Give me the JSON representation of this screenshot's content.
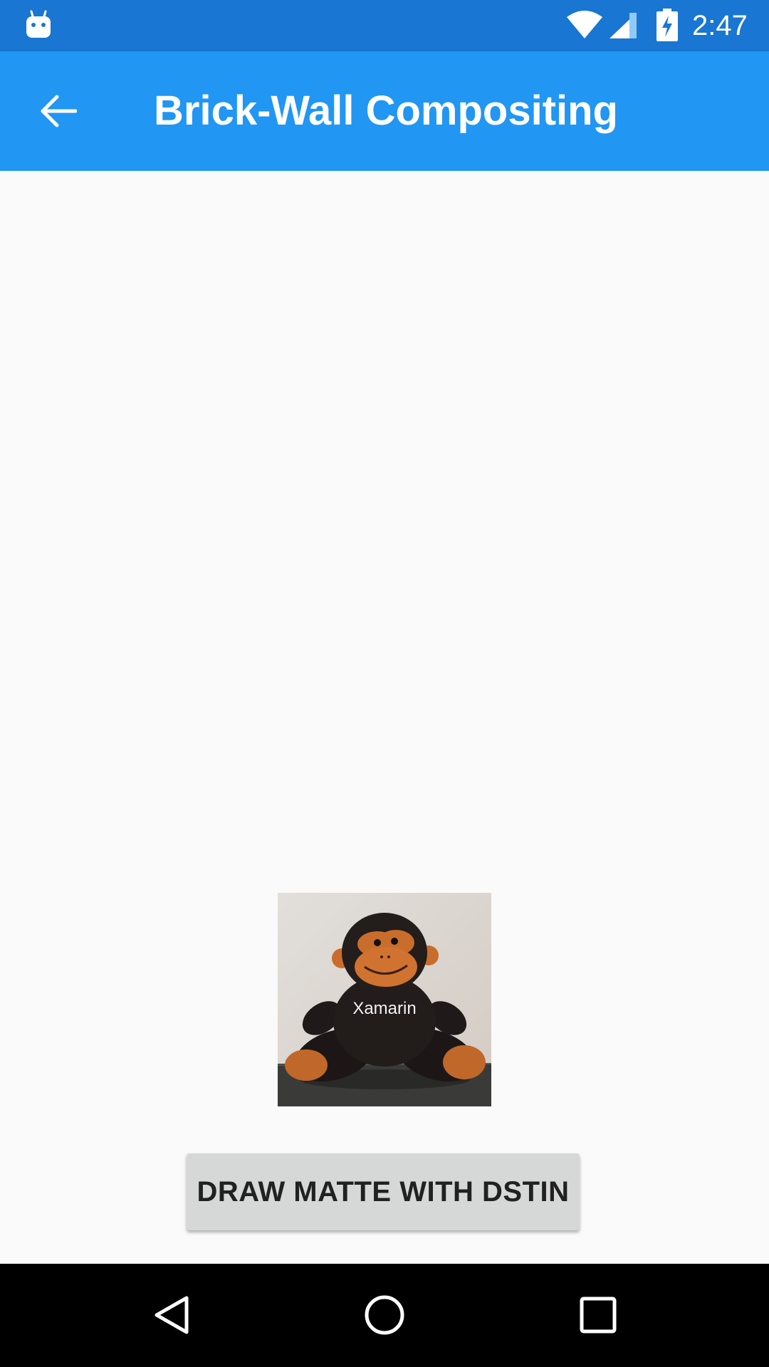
{
  "status_bar": {
    "time": "2:47",
    "icons": [
      "android-notification-icon",
      "wifi-icon",
      "cell-signal-icon",
      "battery-charging-icon"
    ]
  },
  "app_bar": {
    "title": "Brick-Wall Compositing",
    "back_icon": "arrow-back-icon"
  },
  "main": {
    "image": {
      "description_icon": "monkey-plush-photo",
      "shirt_text": "Xamarin"
    },
    "button_label": "DRAW MATTE WITH DSTIN"
  },
  "nav_bar": {
    "icons": [
      "nav-back-icon",
      "nav-home-icon",
      "nav-recents-icon"
    ]
  },
  "colors": {
    "status_bar": "#1976d2",
    "app_bar": "#2196f3",
    "background": "#fafafa",
    "button": "#d6d7d7",
    "nav_bar": "#000000"
  }
}
